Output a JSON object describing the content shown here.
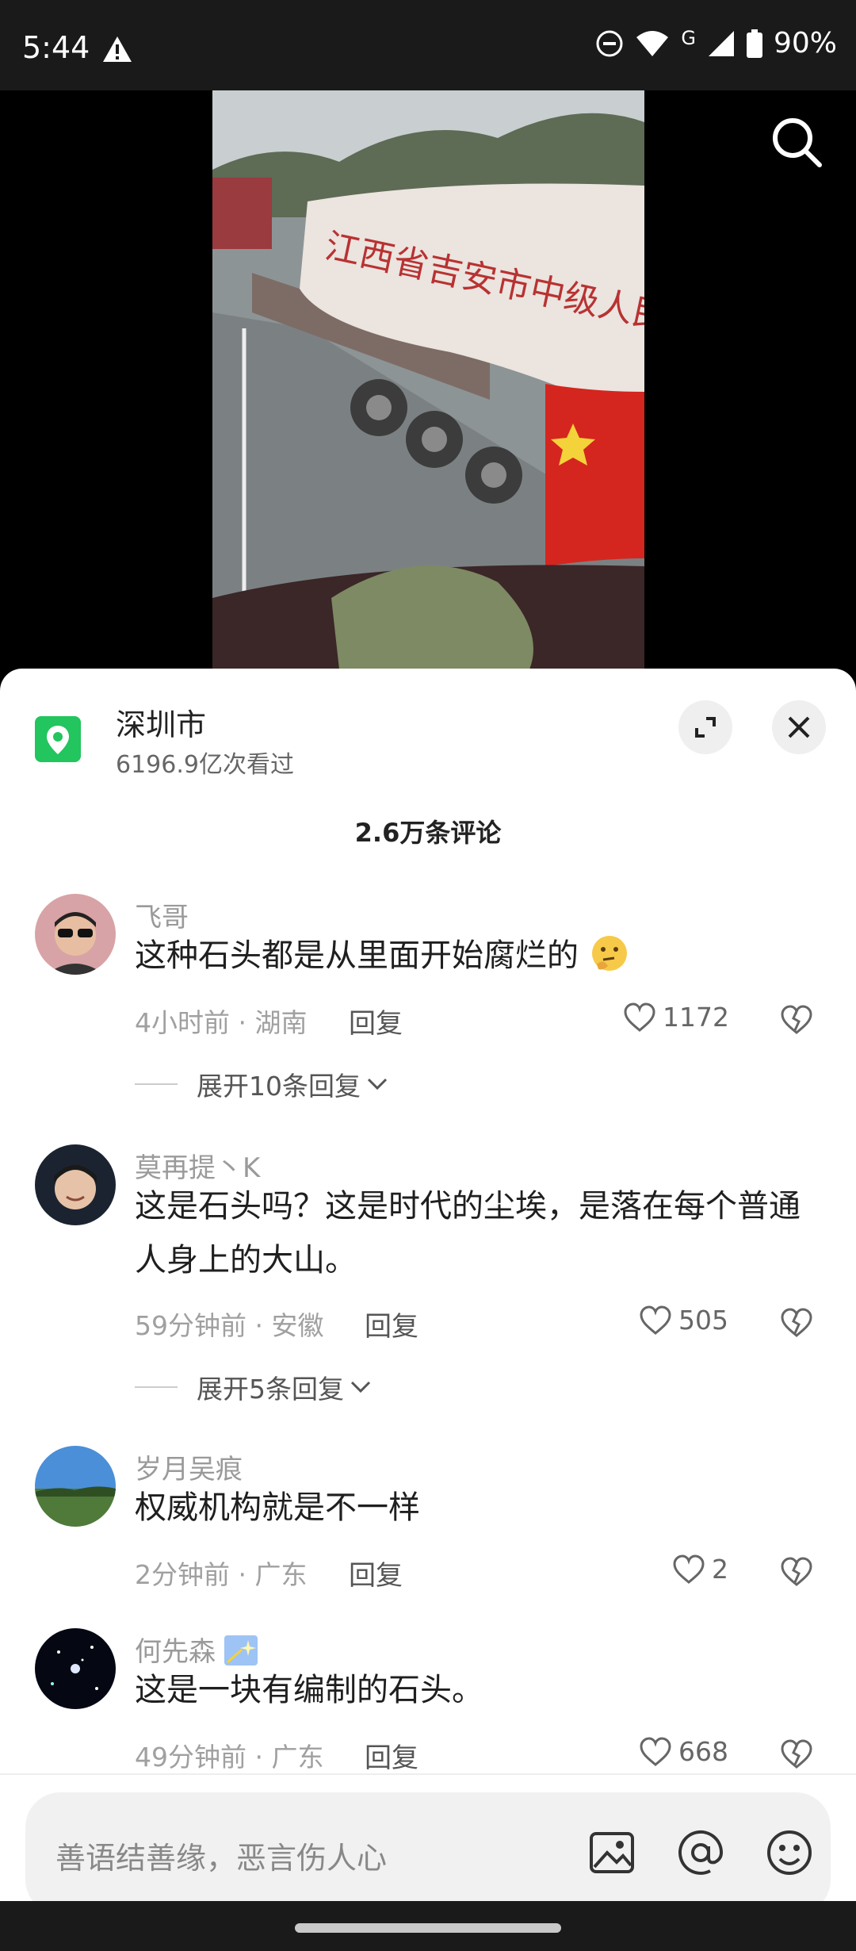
{
  "status_bar": {
    "time": "5:44",
    "battery": "90%",
    "network": "G"
  },
  "location": {
    "name": "深圳市",
    "views": "6196.9亿次看过"
  },
  "comments_title": "2.6万条评论",
  "comments": [
    {
      "user": "飞哥",
      "text": "这种石头都是从里面开始腐烂的",
      "meta": "4小时前 · 湖南",
      "reply": "回复",
      "likes": "1172",
      "expand": "展开10条回复"
    },
    {
      "user": "莫再提丶K",
      "text": "这是石头吗？这是时代的尘埃，是落在每个普通人身上的大山。",
      "meta": "59分钟前 · 安徽",
      "reply": "回复",
      "likes": "505",
      "expand": "展开5条回复"
    },
    {
      "user": "岁月吴痕",
      "text": "权威机构就是不一样",
      "meta": "2分钟前 · 广东",
      "reply": "回复",
      "likes": "2"
    },
    {
      "user": "何先森",
      "text": "这是一块有编制的石头。",
      "meta": "49分钟前 · 广东",
      "reply": "回复",
      "likes": "668"
    }
  ],
  "input": {
    "placeholder": "善语结善缘，恶言伤人心"
  },
  "video": {
    "truck_text": "江西省吉安市中级人民法"
  }
}
